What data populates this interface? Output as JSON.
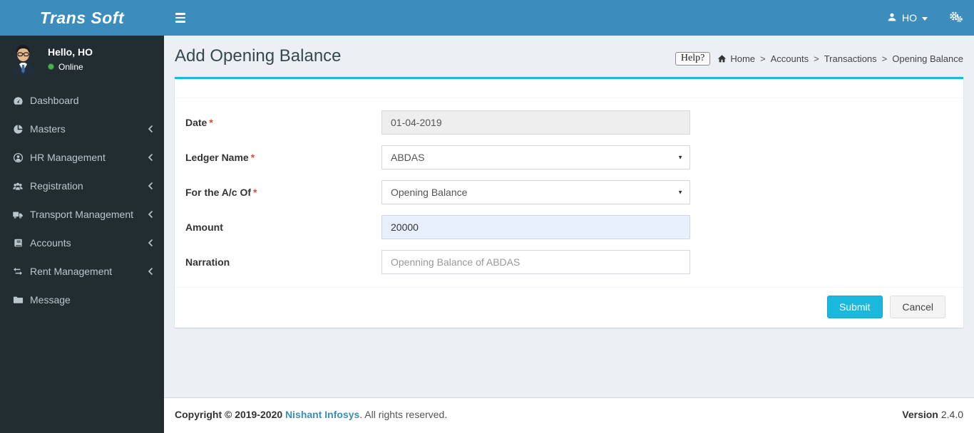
{
  "app": {
    "name": "Trans Soft"
  },
  "navbar": {
    "user_short": "HO"
  },
  "sidebar": {
    "greeting": "Hello, HO",
    "status": "Online",
    "items": [
      {
        "label": "Dashboard",
        "icon": "gauge-icon",
        "has_submenu": false
      },
      {
        "label": "Masters",
        "icon": "pie-chart-icon",
        "has_submenu": true
      },
      {
        "label": "HR Management",
        "icon": "user-circle-icon",
        "has_submenu": true
      },
      {
        "label": "Registration",
        "icon": "users-icon",
        "has_submenu": true
      },
      {
        "label": "Transport Management",
        "icon": "truck-icon",
        "has_submenu": true
      },
      {
        "label": "Accounts",
        "icon": "book-icon",
        "has_submenu": true
      },
      {
        "label": "Rent Management",
        "icon": "exchange-icon",
        "has_submenu": true
      },
      {
        "label": "Message",
        "icon": "folder-icon",
        "has_submenu": false
      }
    ]
  },
  "page": {
    "title": "Add Opening Balance",
    "help_label": "Help?",
    "breadcrumb": [
      "Home",
      "Accounts",
      "Transactions",
      "Opening Balance"
    ],
    "breadcrumb_separator": ">"
  },
  "form": {
    "required_mark": "*",
    "fields": [
      {
        "label": "Date",
        "required": true,
        "control": "input",
        "state": "disabled",
        "value": "01-04-2019"
      },
      {
        "label": "Ledger Name",
        "required": true,
        "control": "select",
        "state": "normal",
        "value": "ABDAS"
      },
      {
        "label": "For the A/c Of",
        "required": true,
        "control": "select",
        "state": "normal",
        "value": "Opening Balance"
      },
      {
        "label": "Amount",
        "required": false,
        "control": "input",
        "state": "autofilled",
        "value": "20000"
      },
      {
        "label": "Narration",
        "required": false,
        "control": "input",
        "state": "muted",
        "value": "Openning Balance of ABDAS"
      }
    ],
    "buttons": {
      "submit": "Submit",
      "cancel": "Cancel"
    }
  },
  "footer": {
    "copyright": "Copyright © 2019-2020",
    "company": "Nishant Infosys",
    "rights": ". All rights reserved.",
    "version_label": "Version",
    "version_value": "2.4.0"
  },
  "icons": {
    "select_caret": "▼"
  },
  "colors": {
    "navbar": "#3c8dbc",
    "sidebar": "#222d32",
    "sidebar_text": "#b8c7ce",
    "content_bg": "#ecf0f5",
    "accent": "#1bb8dd",
    "required": "#dd4b39",
    "online": "#4caf50",
    "link": "#3c8dbc",
    "autofill_bg": "#e8f0fe",
    "disabled_bg": "#eeeeee"
  }
}
